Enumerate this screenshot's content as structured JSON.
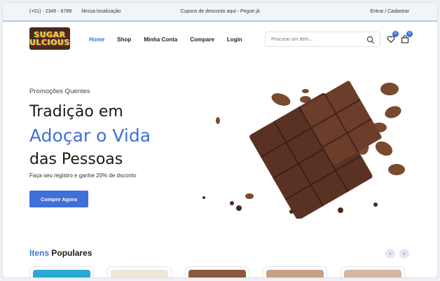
{
  "topbar": {
    "phone": "(+01) - 2345 - 6789",
    "location": "Nessa localização",
    "promo": "Cupons de desconto aqui - Pegue já",
    "auth": "Entrar / Cadastrar"
  },
  "logo": {
    "line1": "SUGAR",
    "line2": "ULCIOUS"
  },
  "nav": [
    "Home",
    "Shop",
    "Minha Conta",
    "Compare",
    "Login"
  ],
  "search": {
    "placeholder": "Procurar um item..."
  },
  "icons": {
    "wishlist_count": "0",
    "cart_count": "0"
  },
  "hero": {
    "subtitle": "Promoções Quentes",
    "title_line1": "Tradição em",
    "title_line2": "Adoçar o Vida",
    "title_line3": "das Pessoas",
    "description": "Faça seu registro e ganhe 20% de dsconto",
    "cta": "Compre Agora"
  },
  "popular": {
    "title_blue": "Itens",
    "title_dark": "Populares"
  },
  "colors": {
    "accent": "#3f6fd8"
  }
}
